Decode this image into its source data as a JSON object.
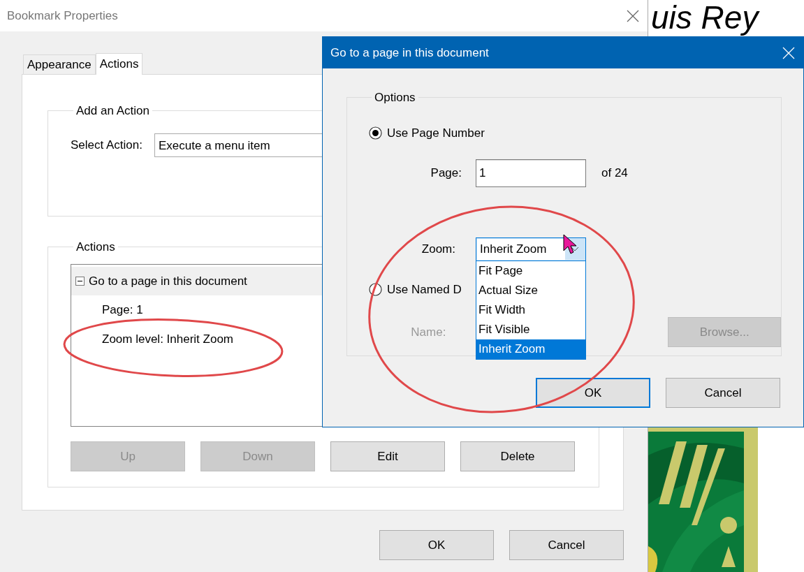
{
  "document": {
    "heading": "uis Rey"
  },
  "bookmark_dialog": {
    "title": "Bookmark Properties",
    "tabs": [
      {
        "label": "Appearance",
        "selected": false
      },
      {
        "label": "Actions",
        "selected": true
      }
    ],
    "add_action": {
      "legend": "Add an Action",
      "select_label": "Select Action:",
      "select_value": "Execute a menu item"
    },
    "actions": {
      "legend": "Actions",
      "items": [
        {
          "label": "Go to a page in this document",
          "expanded": true,
          "children": [
            {
              "label": "Page: 1"
            },
            {
              "label": "Zoom level: Inherit Zoom"
            }
          ]
        }
      ]
    },
    "buttons": [
      {
        "label": "Up",
        "disabled": true
      },
      {
        "label": "Down",
        "disabled": true
      },
      {
        "label": "Edit",
        "disabled": false
      },
      {
        "label": "Delete",
        "disabled": false
      }
    ],
    "footer_buttons": [
      {
        "label": "OK"
      },
      {
        "label": "Cancel"
      }
    ]
  },
  "goto_dialog": {
    "title": "Go to a page in this document",
    "options_legend": "Options",
    "radios": [
      {
        "label": "Use Page Number",
        "selected": true
      },
      {
        "label": "Use Named D",
        "selected": false
      }
    ],
    "page_label": "Page:",
    "page_value": "1",
    "page_total": "of 24",
    "zoom_label": "Zoom:",
    "zoom_value": "Inherit Zoom",
    "zoom_options": [
      {
        "label": "Fit Page",
        "selected": false
      },
      {
        "label": "Actual Size",
        "selected": false
      },
      {
        "label": "Fit Width",
        "selected": false
      },
      {
        "label": "Fit Visible",
        "selected": false
      },
      {
        "label": "Inherit Zoom",
        "selected": true
      }
    ],
    "name_label": "Name:",
    "name_disabled": true,
    "browse": {
      "label": "Browse...",
      "disabled": true
    },
    "buttons": [
      {
        "label": "OK",
        "focused": true
      },
      {
        "label": "Cancel",
        "focused": false
      }
    ]
  }
}
